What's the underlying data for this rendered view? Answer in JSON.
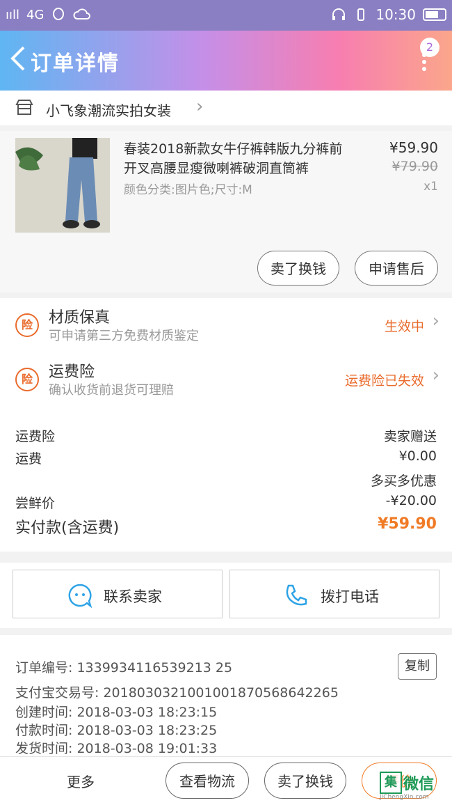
{
  "status_bar": {
    "signal": "ııll",
    "network": "4G",
    "time": "10:30"
  },
  "header": {
    "title": "订单详情",
    "notification_count": "2"
  },
  "shop": {
    "name": "小飞象潮流实拍女装"
  },
  "product": {
    "title": "春装2018新款女牛仔裤韩版九分裤前开叉高腰显瘦微喇裤破洞直筒裤",
    "sku": "颜色分类:图片色;尺寸:M",
    "price": "¥59.90",
    "original_price": "¥79.90",
    "quantity": "x1",
    "actions": [
      "卖了换钱",
      "申请售后"
    ]
  },
  "insurance": [
    {
      "name": "材质保真",
      "desc": "可申请第三方免费材质鉴定",
      "status": "生效中"
    },
    {
      "name": "运费险",
      "desc": "确认收货前退货可理赔",
      "status": "运费险已失效"
    }
  ],
  "badge_text": "险",
  "fees": [
    {
      "label": "运费险",
      "value": "卖家赠送"
    },
    {
      "label": "运费",
      "value": "¥0.00"
    },
    {
      "label": "",
      "value": "多买多优惠"
    },
    {
      "label": "尝鲜价",
      "value": "-¥20.00"
    }
  ],
  "total": {
    "label": "实付款(含运费)",
    "value": "¥59.90"
  },
  "contact": {
    "seller": "联系卖家",
    "phone": "拨打电话"
  },
  "order_info": {
    "order_no": "订单编号: 1339934116539213 25",
    "alipay_no": "支付宝交易号: 2018030321001001870568642265",
    "created": "创建时间: 2018-03-03 18:23:15",
    "paid": "付款时间: 2018-03-03 18:23:25",
    "shipped": "发货时间: 2018-03-08 19:01:33",
    "copy": "复制"
  },
  "bottom_bar": {
    "more": "更多",
    "logistics": "查看物流",
    "sell": "卖了换钱",
    "review": "评价"
  },
  "watermark": {
    "mark": "集",
    "text": "微信",
    "url": "JiChengXin.com"
  },
  "colors": {
    "accent": "#f07a25",
    "header_start": "#5fb6f2",
    "header_end": "#fba68b"
  }
}
